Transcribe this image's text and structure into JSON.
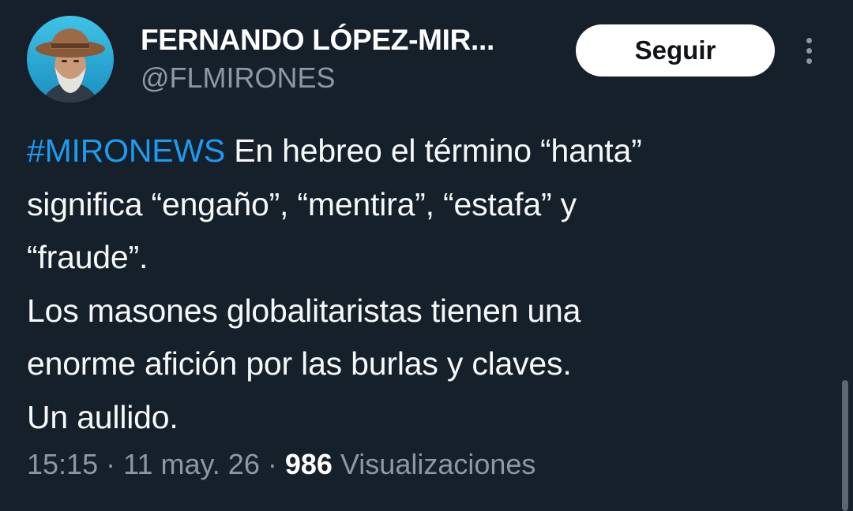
{
  "author": {
    "display_name": "FERNANDO LÓPEZ-MIR...",
    "handle": "@FLMIRONES",
    "avatar_icon": "user-avatar"
  },
  "actions": {
    "follow_label": "Seguir",
    "more_icon": "more-vertical-icon"
  },
  "tweet": {
    "hashtag": "#MIRONEWS",
    "line1_rest": " En hebreo el término “hanta”",
    "line2": "significa “engaño”, “mentira”, “estafa” y",
    "line3": "“fraude”.",
    "line4": "Los masones globalitaristas tienen una",
    "line5": "enorme afición por las burlas y claves.",
    "line6": "Un aullido."
  },
  "meta": {
    "time": "15:15",
    "separator": " · ",
    "date": "11 may. 26",
    "views_count": "986",
    "views_label": " Visualizaciones"
  },
  "colors": {
    "background": "#15202b",
    "hashtag": "#1d9bf0",
    "secondary_text": "#8b98a5"
  }
}
